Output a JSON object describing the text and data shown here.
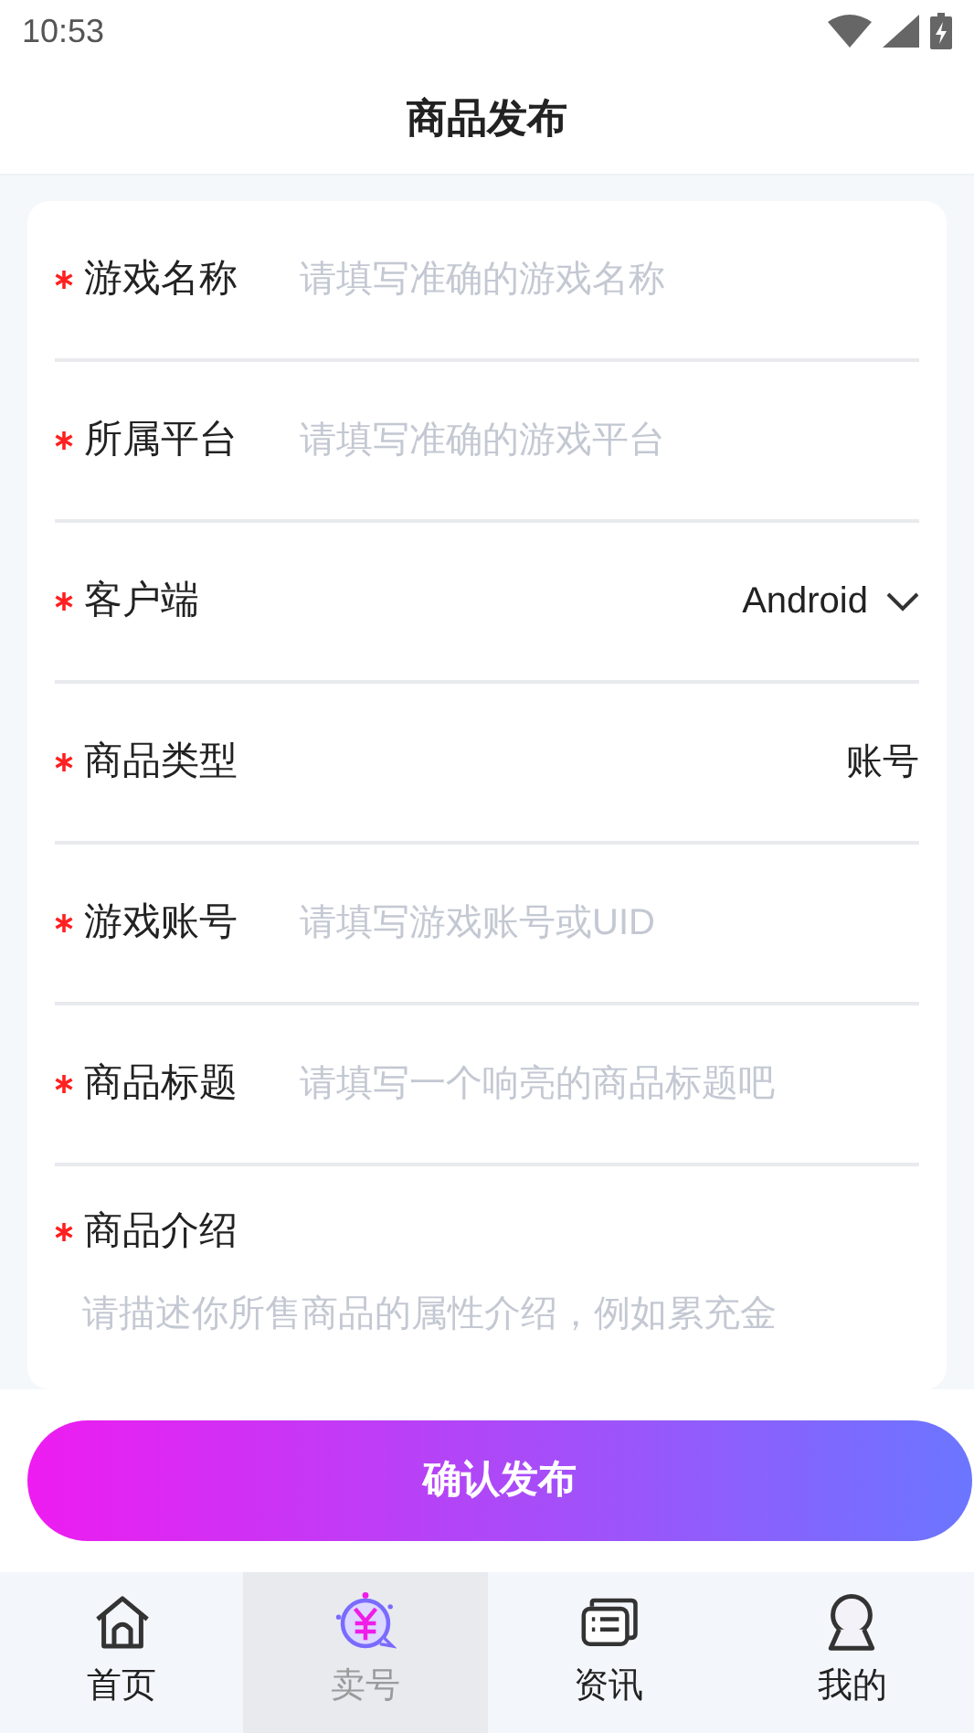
{
  "status_bar": {
    "time": "10:53"
  },
  "header": {
    "title": "商品发布"
  },
  "form": {
    "fields": [
      {
        "kind": "input",
        "label": "游戏名称",
        "required": true,
        "placeholder": "请填写准确的游戏名称"
      },
      {
        "kind": "input",
        "label": "所属平台",
        "required": true,
        "placeholder": "请填写准确的游戏平台"
      },
      {
        "kind": "select",
        "label": "客户端",
        "required": true,
        "value": "Android"
      },
      {
        "kind": "value",
        "label": "商品类型",
        "required": true,
        "value": "账号"
      },
      {
        "kind": "input",
        "label": "游戏账号",
        "required": true,
        "placeholder": "请填写游戏账号或UID"
      },
      {
        "kind": "input",
        "label": "商品标题",
        "required": true,
        "placeholder": "请填写一个响亮的商品标题吧"
      },
      {
        "kind": "textarea",
        "label": "商品介绍",
        "required": true,
        "placeholder": "请描述你所售商品的属性介绍，例如累充金"
      }
    ]
  },
  "submit_button": {
    "label": "确认发布"
  },
  "tab_bar": [
    {
      "label": "首页",
      "selected": false
    },
    {
      "label": "卖号",
      "selected": true
    },
    {
      "label": "资讯",
      "selected": false
    },
    {
      "label": "我的",
      "selected": false
    }
  ]
}
